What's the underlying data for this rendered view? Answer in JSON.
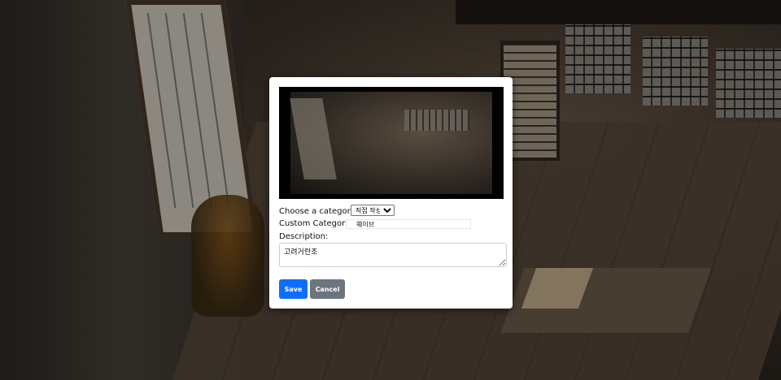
{
  "form": {
    "category_label": "Choose a category:",
    "category_selected": "직접 작성...",
    "custom_label": "Custom Category:",
    "custom_value": "웨이브",
    "description_label": "Description:",
    "description_value": "고려거란조"
  },
  "buttons": {
    "save": "Save",
    "cancel": "Cancel"
  },
  "colors": {
    "save": "#0d6efd",
    "cancel": "#6c757d"
  }
}
